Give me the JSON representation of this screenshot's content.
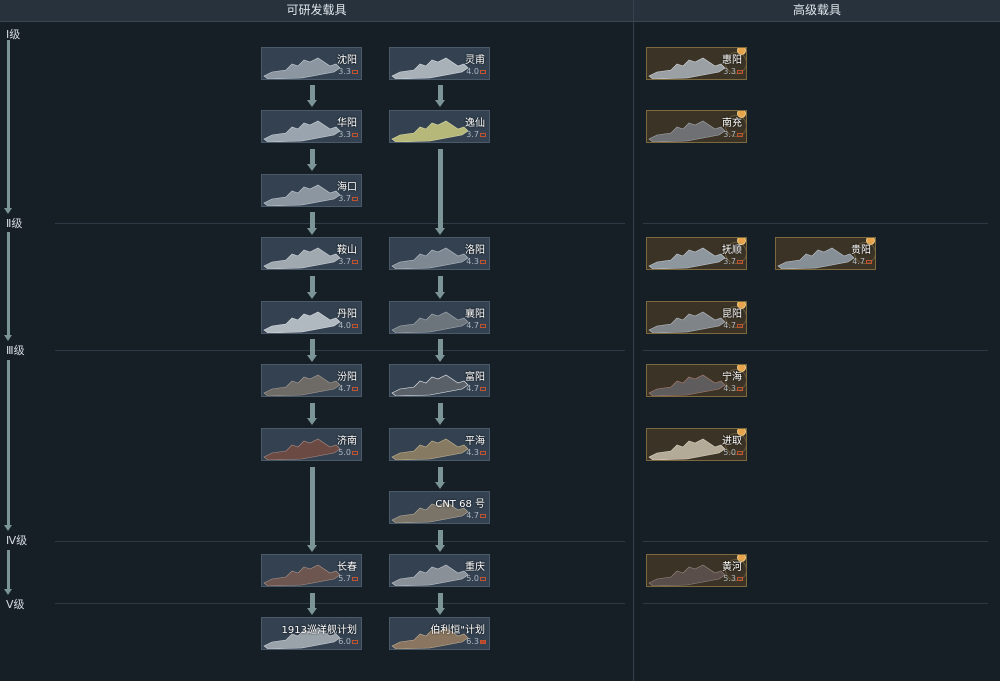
{
  "headers": {
    "researchable": "可研发载具",
    "premium": "高级载具"
  },
  "ranks": [
    "Ⅰ级",
    "Ⅱ级",
    "Ⅲ级",
    "Ⅳ级",
    "Ⅴ级"
  ],
  "colors": {
    "background": "#161e26",
    "card": "#334150",
    "premium_card": "#3a3326",
    "arrow": "#7a9497",
    "premium_badge": "#e8a44a"
  },
  "vehicles": [
    {
      "name": "沈阳",
      "br": "3.3",
      "premium": false
    },
    {
      "name": "灵甫",
      "br": "4.0",
      "premium": false
    },
    {
      "name": "华阳",
      "br": "3.3",
      "premium": false
    },
    {
      "name": "逸仙",
      "br": "3.7",
      "premium": false
    },
    {
      "name": "海口",
      "br": "3.7",
      "premium": false
    },
    {
      "name": "鞍山",
      "br": "3.7",
      "premium": false
    },
    {
      "name": "洛阳",
      "br": "4.3",
      "premium": false
    },
    {
      "name": "丹阳",
      "br": "4.0",
      "premium": false
    },
    {
      "name": "襄阳",
      "br": "4.7",
      "premium": false
    },
    {
      "name": "汾阳",
      "br": "4.7",
      "premium": false
    },
    {
      "name": "富阳",
      "br": "4.7",
      "premium": false
    },
    {
      "name": "济南",
      "br": "5.0",
      "premium": false
    },
    {
      "name": "平海",
      "br": "4.3",
      "premium": false
    },
    {
      "name": "CNT 68 号",
      "br": "4.7",
      "premium": false
    },
    {
      "name": "长春",
      "br": "5.7",
      "premium": false
    },
    {
      "name": "重庆",
      "br": "5.0",
      "premium": false
    },
    {
      "name": "1913巡洋舰计划",
      "br": "6.0",
      "premium": false
    },
    {
      "name": "伯利恒\"计划",
      "br": "6.3",
      "premium": false
    },
    {
      "name": "惠阳",
      "br": "3.3",
      "premium": true
    },
    {
      "name": "南充",
      "br": "3.7",
      "premium": true
    },
    {
      "name": "抚顺",
      "br": "3.7",
      "premium": true
    },
    {
      "name": "贵阳",
      "br": "4.7",
      "premium": true
    },
    {
      "name": "昆阳",
      "br": "4.7",
      "premium": true
    },
    {
      "name": "宁海",
      "br": "4.3",
      "premium": true
    },
    {
      "name": "进取",
      "br": "5.0",
      "premium": true
    },
    {
      "name": "黄河",
      "br": "5.3",
      "premium": true
    }
  ]
}
